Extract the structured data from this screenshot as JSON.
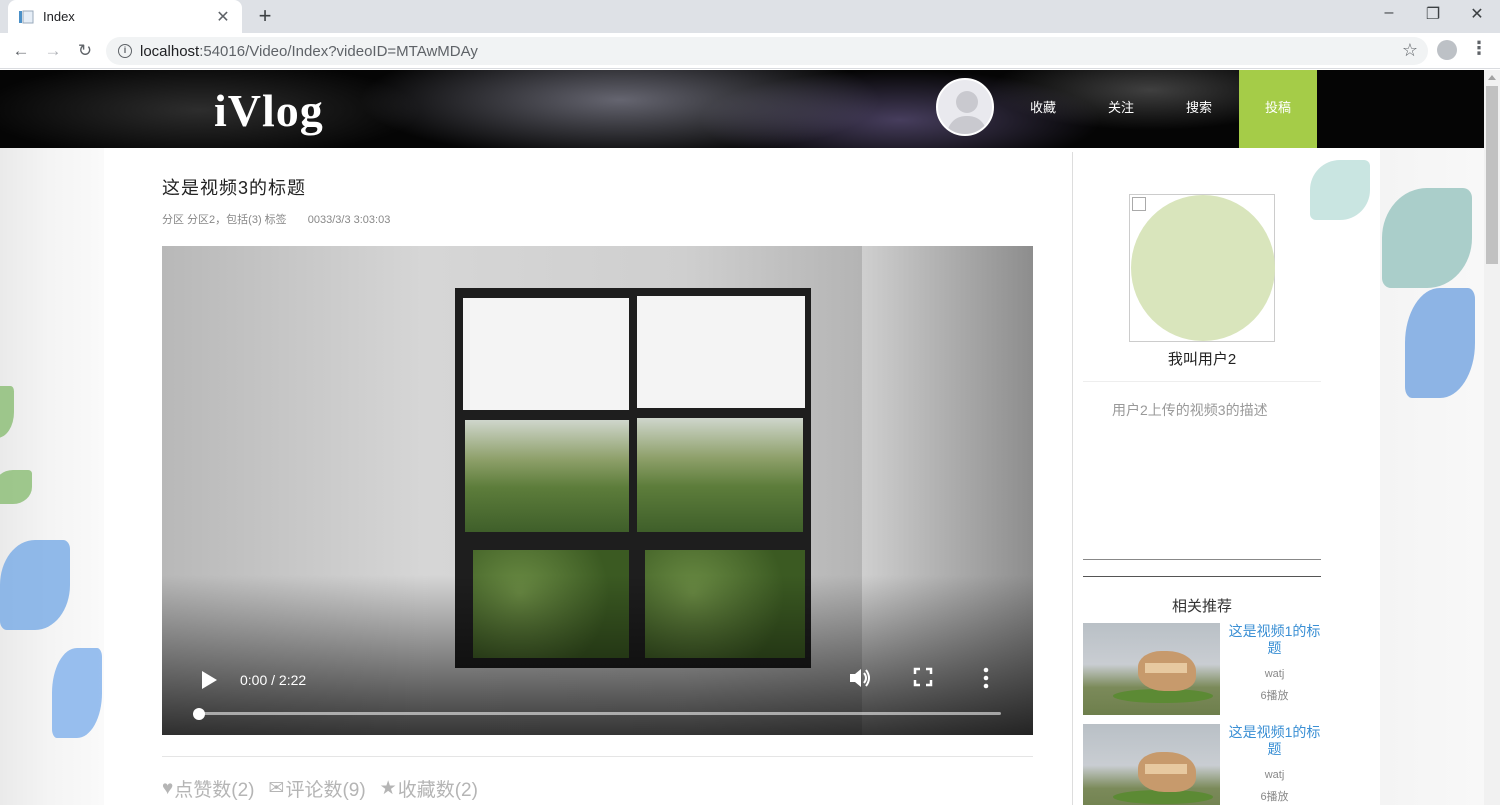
{
  "browser": {
    "tab_title": "Index",
    "tab_close": "✕",
    "new_tab": "+",
    "url_host": "localhost",
    "url_rest": ":54016/Video/Index?videoID=MTAwMDAy",
    "back": "←",
    "forward": "→",
    "reload": "↻",
    "bookmark_icon": "☆",
    "menu_icon": "⋮",
    "minimize": "–",
    "restore": "❐",
    "close": "✕"
  },
  "header": {
    "logo": "iVlog",
    "nav": [
      {
        "label": "收藏"
      },
      {
        "label": "关注"
      },
      {
        "label": "搜索"
      },
      {
        "label": "投稿"
      }
    ],
    "upload_color": "#a5cc48"
  },
  "video": {
    "title": "这是视频3的标题",
    "category": "分区 分区2，包括(3) 标签",
    "date": "0033/3/3 3:03:03",
    "time": "0:00 / 2:22",
    "progress": 0.0,
    "volume_icon": "🔊",
    "fullscreen_icon": "⛶",
    "more_icon": "⋮"
  },
  "stats": {
    "likes_icon": "♥",
    "likes": "点赞数(2)",
    "comments_icon": "✉",
    "comments": "评论数(9)",
    "favorites_icon": "★",
    "favorites": "收藏数(2)"
  },
  "sidebar": {
    "uploader_name": "我叫用户2",
    "description": "用户2上传的视频3的描述",
    "related_title": "相关推荐",
    "recommendations": [
      {
        "title": "这是视频1的标题",
        "author": "watj",
        "plays": "6播放"
      },
      {
        "title": "这是视频1的标题",
        "author": "watj",
        "plays": "6播放"
      }
    ],
    "title_color": "#3a8fd4"
  }
}
